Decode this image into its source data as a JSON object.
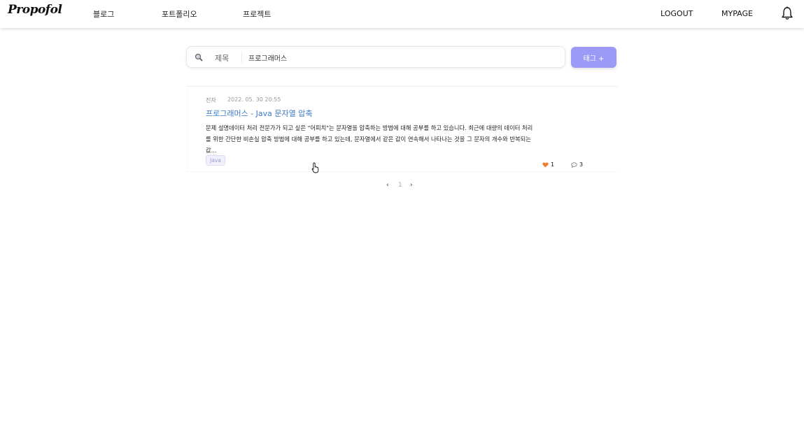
{
  "header": {
    "logo": "Propofol",
    "nav": [
      "블로그",
      "포트폴리오",
      "프로젝트"
    ],
    "logout": "LOGOUT",
    "mypage": "MYPAGE",
    "bell_icon": "bell-icon"
  },
  "search": {
    "icon": "search-icon",
    "type": "제목",
    "value": "프로그래머스",
    "tag_button": "태그 +"
  },
  "post": {
    "author": "진자",
    "date": "2022. 05. 30 20:55",
    "title": "프로그래머스 - Java 문자열 압축",
    "excerpt": "문제 설명데이터 처리 전문가가 되고 싶은 \"어피치\"는 문자열을 압축하는 방법에 대해 공부를 하고 있습니다. 최근에 대량의 데이터 처리를 위한 간단한 비손실 압축 방법에 대해 공부를 하고 있는데, 문자열에서 같은 값이 연속해서 나타나는 것을 그 문자의 개수와 반복되는 값...",
    "tag": "Java",
    "likes": "1",
    "comments": "3"
  },
  "pagination": {
    "prev": "‹",
    "current": "1",
    "next": "›"
  },
  "colors": {
    "accent": "#9b9bf7",
    "title_link": "#3b7cc9",
    "heart": "#f07d2e"
  }
}
